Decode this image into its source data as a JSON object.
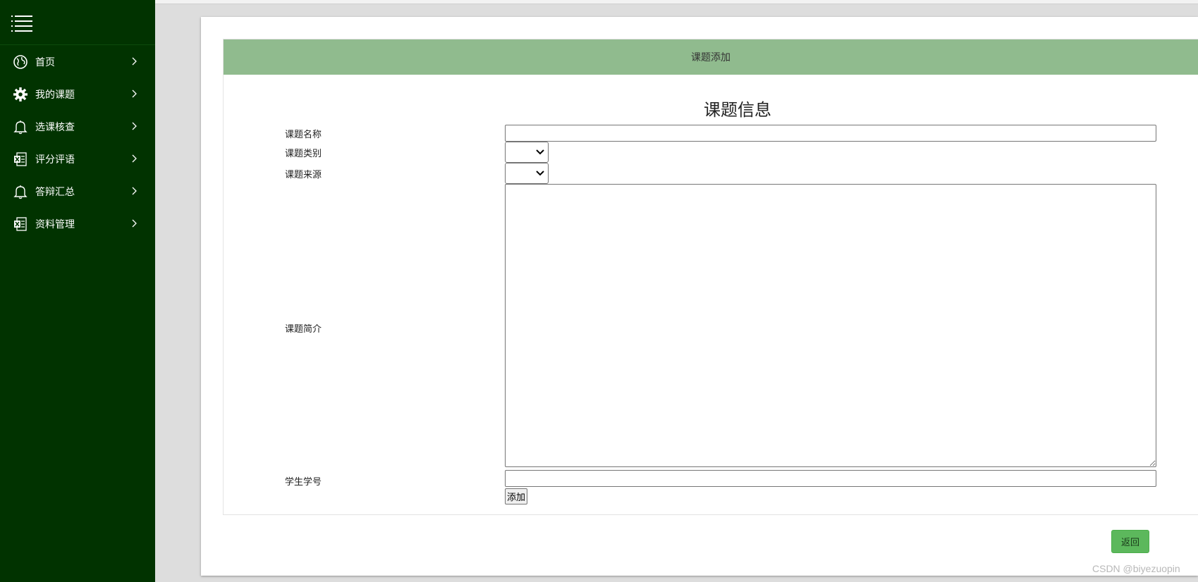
{
  "sidebar": {
    "menu_icon": "menu-list-icon",
    "items": [
      {
        "label": "首页",
        "icon": "globe-icon"
      },
      {
        "label": "我的课题",
        "icon": "gear-icon"
      },
      {
        "label": "选课核查",
        "icon": "bell-icon"
      },
      {
        "label": "评分评语",
        "icon": "excel-file-icon"
      },
      {
        "label": "答辩汇总",
        "icon": "bell-icon"
      },
      {
        "label": "资料管理",
        "icon": "excel-file-icon"
      }
    ]
  },
  "panel": {
    "header": "课题添加"
  },
  "form": {
    "title": "课题信息",
    "fields": {
      "name_label": "课题名称",
      "category_label": "课题类别",
      "source_label": "课题来源",
      "intro_label": "课题简介",
      "student_label": "学生学号"
    },
    "values": {
      "name": "",
      "category": "",
      "source": "",
      "intro": "",
      "student": ""
    },
    "submit_label": "添加"
  },
  "actions": {
    "back_label": "返回"
  },
  "watermark": "CSDN @biyezuopin",
  "colors": {
    "sidebar_bg": "#013300",
    "panel_header_bg": "#90bb8e",
    "back_button_bg": "#5cb85c",
    "content_bg": "#dddddd"
  }
}
